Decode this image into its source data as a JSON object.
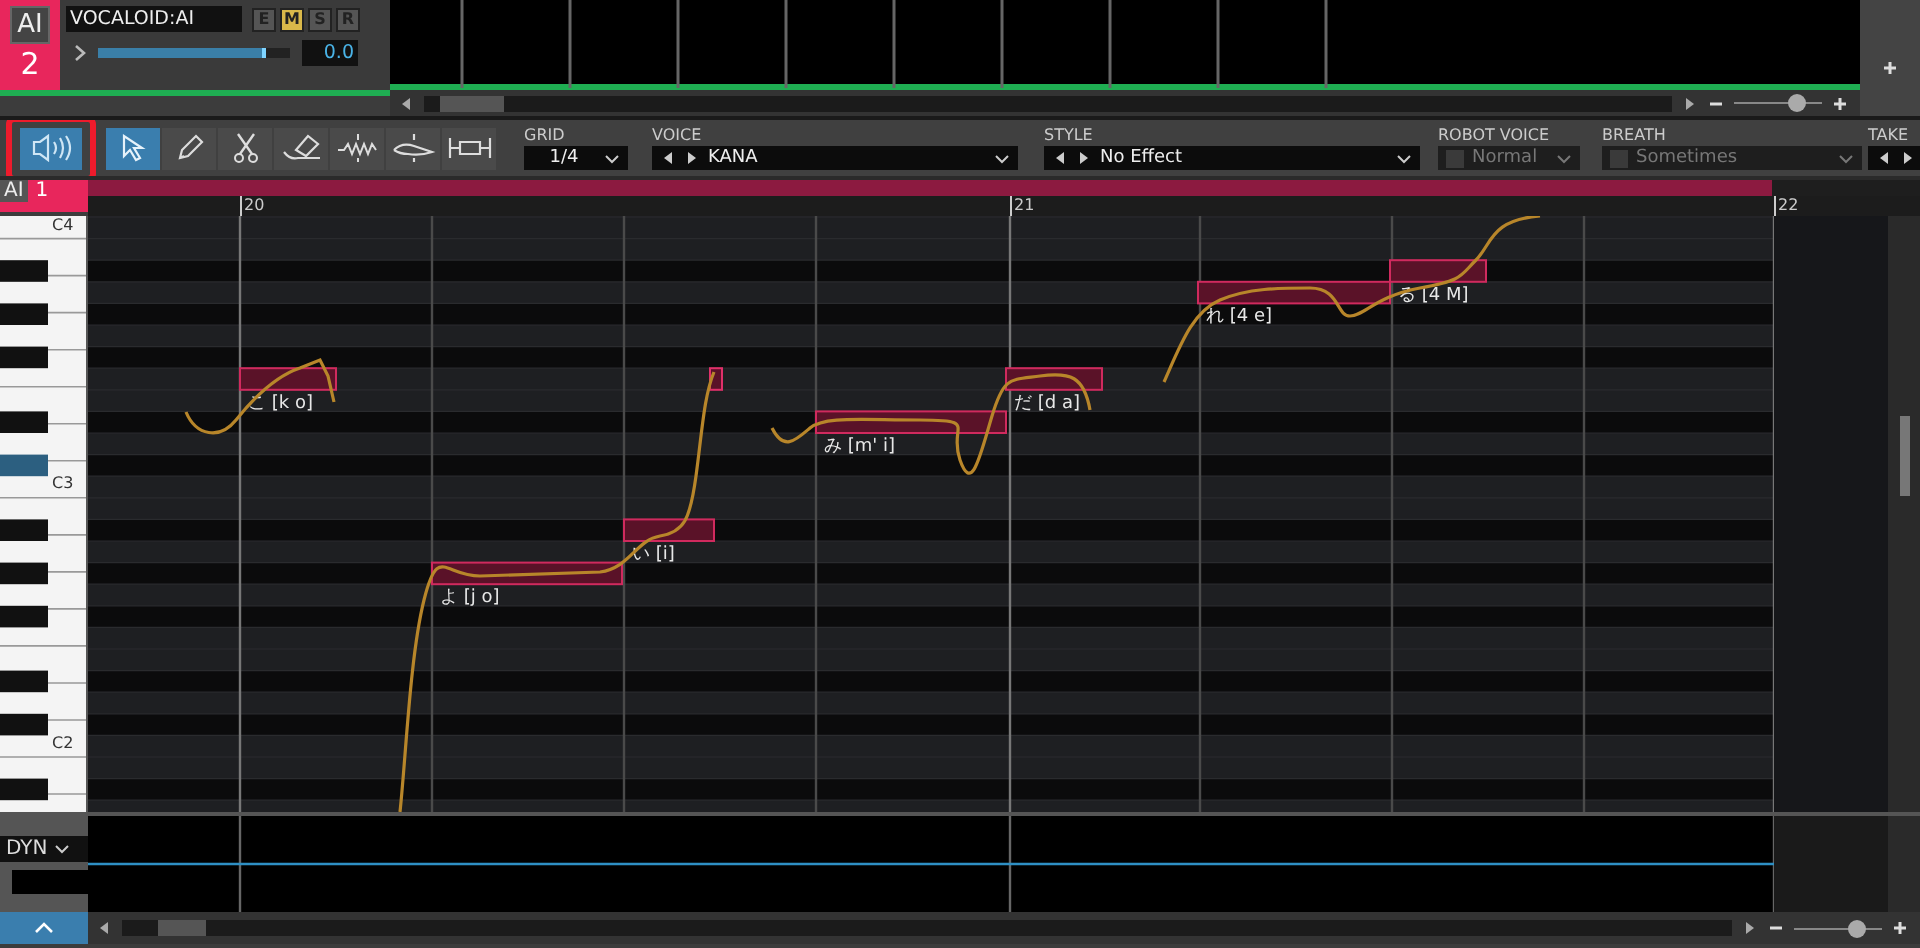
{
  "track": {
    "badge": "AI",
    "number": "2",
    "name": "VOCALOID:AI",
    "buttons": [
      {
        "label": "E",
        "on": false
      },
      {
        "label": "M",
        "on": true
      },
      {
        "label": "S",
        "on": false
      },
      {
        "label": "R",
        "on": false
      }
    ],
    "volume": {
      "level": 0.88,
      "reading": "0.0"
    }
  },
  "arrangement": {
    "zoom": {
      "level": 0.7
    }
  },
  "toolbar": {
    "speaker": {
      "on": true,
      "highlighted": true
    },
    "tools": [
      {
        "kind": "select",
        "selected": true
      },
      {
        "kind": "pencil",
        "selected": false
      },
      {
        "kind": "scissors",
        "selected": false
      },
      {
        "kind": "eraser",
        "selected": false
      },
      {
        "kind": "vibrato",
        "selected": false
      },
      {
        "kind": "pitch",
        "selected": false
      },
      {
        "kind": "stretch",
        "selected": false
      }
    ],
    "dropdowns": [
      {
        "kind": "plain",
        "label": "GRID",
        "value": "1/4",
        "disabled": false
      },
      {
        "kind": "arrows",
        "label": "VOICE",
        "value": "KANA",
        "disabled": false
      },
      {
        "kind": "arrows",
        "label": "STYLE",
        "value": "No Effect",
        "disabled": false
      },
      {
        "kind": "checkbox",
        "label": "ROBOT VOICE",
        "value": "Normal",
        "disabled": true
      },
      {
        "kind": "checkbox",
        "label": "BREATH",
        "value": "Sometimes",
        "disabled": true
      },
      {
        "kind": "arrows",
        "label": "TAKE",
        "disabled": false
      }
    ]
  },
  "part": {
    "badge": "AI",
    "number": "1"
  },
  "ruler": [
    "20",
    "21",
    "22"
  ],
  "keyboard": {
    "labels": [
      "C4",
      "C3",
      "C2"
    ]
  },
  "notes": [
    {
      "kind": "note",
      "lyric": "こ [k o]"
    },
    {
      "kind": "note",
      "lyric": "よ [j o]"
    },
    {
      "kind": "note",
      "lyric": "い [i]"
    },
    {
      "kind": "blip"
    },
    {
      "kind": "note",
      "lyric": "み [m' i]"
    },
    {
      "kind": "note",
      "lyric": "だ [d a]"
    },
    {
      "kind": "note",
      "lyric": "れ [4 e]"
    },
    {
      "kind": "note",
      "lyric": "る [4 M]"
    }
  ],
  "lower_pane": {
    "parameter": "DYN"
  },
  "bottom": {
    "zoom": {
      "level": 0.7
    }
  }
}
